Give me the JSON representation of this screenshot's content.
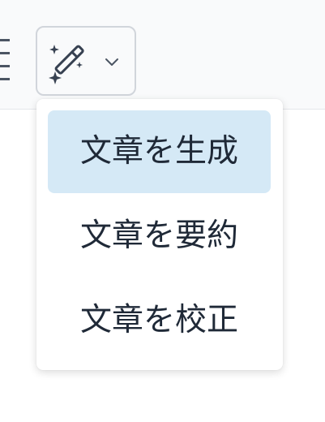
{
  "toolbar": {
    "list_icon": "list-icon",
    "ai_button": {
      "icon": "magic-wand-sparkles-icon",
      "chevron": "chevron-down-icon"
    }
  },
  "menu": {
    "items": [
      {
        "label": "文章を生成",
        "active": true
      },
      {
        "label": "文章を要約",
        "active": false
      },
      {
        "label": "文章を校正",
        "active": false
      }
    ]
  },
  "colors": {
    "toolbar_bg": "#f9fafb",
    "highlight": "#d5e9f6",
    "text": "#1f2937",
    "icon": "#4b5563"
  }
}
